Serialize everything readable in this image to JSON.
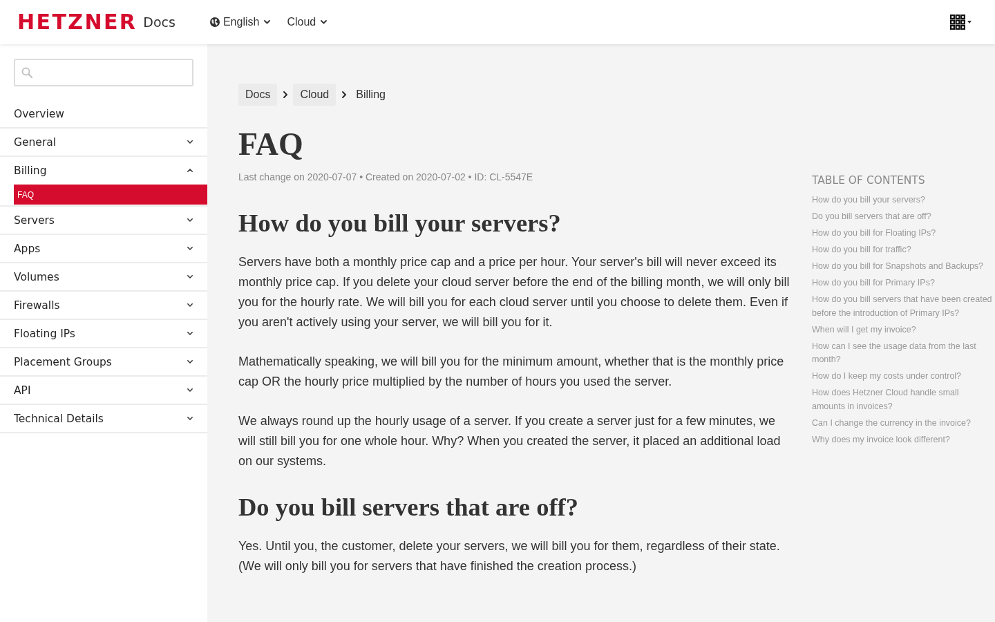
{
  "header": {
    "logo": "HETZNER",
    "product": "Docs",
    "nav": [
      {
        "label": "English",
        "kind": "language"
      },
      {
        "label": "Cloud",
        "kind": "menu"
      }
    ]
  },
  "sidebar": {
    "items": [
      {
        "label": "Overview",
        "kind": "link"
      },
      {
        "label": "General",
        "kind": "group",
        "expanded": false
      },
      {
        "label": "Billing",
        "kind": "group",
        "expanded": true,
        "children": [
          {
            "label": "FAQ",
            "selected": true
          }
        ]
      },
      {
        "label": "Servers",
        "kind": "group",
        "expanded": false
      },
      {
        "label": "Apps",
        "kind": "group",
        "expanded": false
      },
      {
        "label": "Volumes",
        "kind": "group",
        "expanded": false
      },
      {
        "label": "Firewalls",
        "kind": "group",
        "expanded": false
      },
      {
        "label": "Floating IPs",
        "kind": "group",
        "expanded": false
      },
      {
        "label": "Placement Groups",
        "kind": "group",
        "expanded": false
      },
      {
        "label": "API",
        "kind": "group",
        "expanded": false
      },
      {
        "label": "Technical Details",
        "kind": "group",
        "expanded": false
      }
    ]
  },
  "breadcrumbs": [
    {
      "label": "Docs",
      "kind": "link"
    },
    {
      "label": "Cloud",
      "kind": "link"
    },
    {
      "label": "Billing",
      "kind": "current"
    }
  ],
  "article": {
    "title": "FAQ",
    "meta": "Last change on 2020-07-07 • Created on 2020-07-02 • ID: CL-5547E",
    "sections": [
      {
        "heading": "How do you bill your servers?",
        "paragraphs": [
          "Servers have both a monthly price cap and a price per hour. Your server's bill will never exceed its monthly price cap. If you delete your cloud server before the end of the billing month, we will only bill you for the hourly rate. We will bill you for each cloud server until you choose to delete them. Even if you aren't actively using your server, we will bill you for it.",
          "Mathematically speaking, we will bill you for the minimum amount, whether that is the monthly price cap OR the hourly price multiplied by the number of hours you used the server.",
          "We always round up the hourly usage of a server. If you create a server just for a few minutes, we will still bill you for one whole hour. Why? When you created the server, it placed an additional load on our systems."
        ]
      },
      {
        "heading": "Do you bill servers that are off?",
        "paragraphs": [
          "Yes. Until you, the customer, delete your servers, we will bill you for them, regardless of their state. (We will only bill you for servers that have finished the creation process.)"
        ]
      }
    ]
  },
  "toc": {
    "title": "TABLE OF CONTENTS",
    "items": [
      "How do you bill your servers?",
      "Do you bill servers that are off?",
      "How do you bill for Floating IPs?",
      "How do you bill for traffic?",
      "How do you bill for Snapshots and Backups?",
      "How do you bill for Primary IPs?",
      "How do you bill servers that have been created before the introduction of Primary IPs?",
      "When will I get my invoice?",
      "How can I see the usage data from the last month?",
      "How do I keep my costs under control?",
      "How does Hetzner Cloud handle small amounts in invoices?",
      "Can I change the currency in the invoice?",
      "Why does my invoice look different?"
    ]
  }
}
